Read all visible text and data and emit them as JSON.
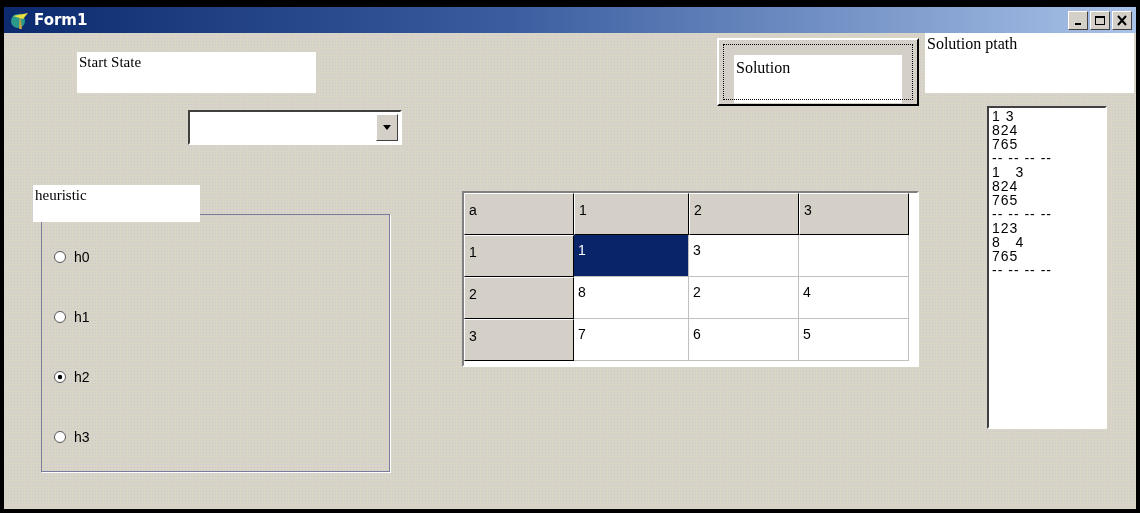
{
  "window": {
    "title": "Form1"
  },
  "start_state_label": "Start State",
  "heuristic": {
    "label": "heuristic",
    "options": [
      {
        "label": "h0",
        "selected": false
      },
      {
        "label": "h1",
        "selected": false
      },
      {
        "label": "h2",
        "selected": true
      },
      {
        "label": "h3",
        "selected": false
      }
    ]
  },
  "solution_button": {
    "label": "Solution"
  },
  "solution_path_label": "Solution ptath",
  "grid": {
    "columns": [
      "a",
      "1",
      "2",
      "3"
    ],
    "rows": [
      {
        "cells": [
          {
            "kind": "header",
            "text": "1",
            "selected": false
          },
          {
            "kind": "data",
            "text": "1",
            "selected": true
          },
          {
            "kind": "data",
            "text": "3",
            "selected": false
          },
          {
            "kind": "data",
            "selected": false
          }
        ]
      },
      {
        "cells": [
          {
            "kind": "header",
            "text": "2",
            "selected": false
          },
          {
            "kind": "data",
            "text": "8",
            "selected": false
          },
          {
            "kind": "data",
            "text": "2",
            "selected": false
          },
          {
            "kind": "data",
            "text": "4",
            "selected": false
          }
        ]
      },
      {
        "cells": [
          {
            "kind": "header",
            "text": "3",
            "selected": false
          },
          {
            "kind": "data",
            "text": "7",
            "selected": false
          },
          {
            "kind": "data",
            "text": "6",
            "selected": false
          },
          {
            "kind": "data",
            "text": "5",
            "selected": false
          }
        ]
      }
    ]
  },
  "path_list": [
    "1 3",
    "824",
    "765",
    "-- -- -- --",
    "1   3",
    "824",
    "765",
    "-- -- -- --",
    "123",
    "8   4",
    "765",
    "-- -- -- --"
  ]
}
